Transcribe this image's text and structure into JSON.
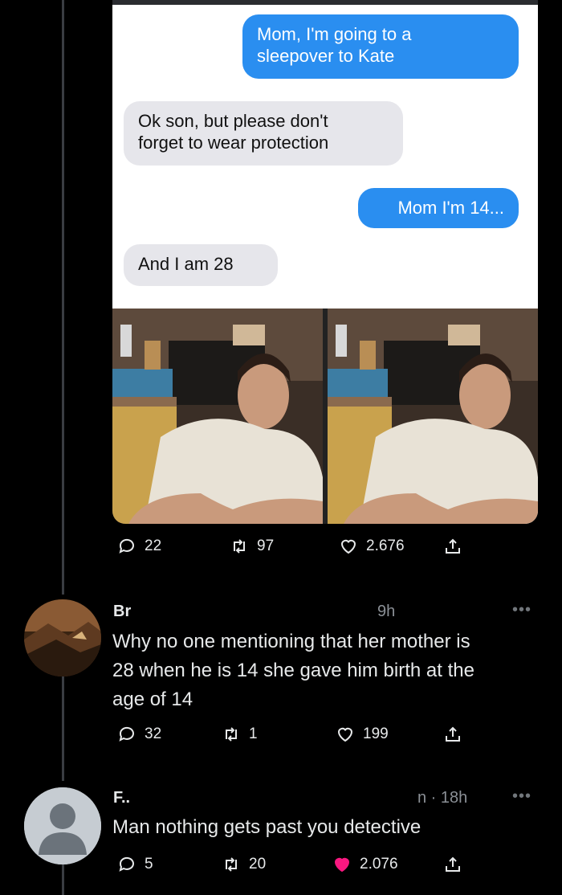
{
  "post": {
    "chat": {
      "msg1": "Mom, I'm going to a\nsleepover to Kate",
      "msg2": "Ok son, but please don't\nforget to wear protection",
      "msg3": "Mom I'm 14...",
      "msg4": "And I am 28"
    },
    "stats": {
      "replies": "22",
      "retweets": "97",
      "likes": "2.676"
    }
  },
  "reply1": {
    "name": "Br",
    "time": "9h",
    "text_lines": [
      "Why no one mentioning that her mother is",
      "28 when he is 14 she gave him birth at the",
      "age of 14"
    ],
    "stats": {
      "replies": "32",
      "retweets": "1",
      "likes": "199"
    }
  },
  "reply2": {
    "name": "F..",
    "time": "n · 18h",
    "text": "Man nothing gets past you detective",
    "stats": {
      "replies": "5",
      "retweets": "20",
      "likes": "2.076"
    },
    "liked_color": "#f91880"
  },
  "icons": [
    "reply-icon",
    "retweet-icon",
    "like-icon",
    "share-icon",
    "more-icon"
  ]
}
